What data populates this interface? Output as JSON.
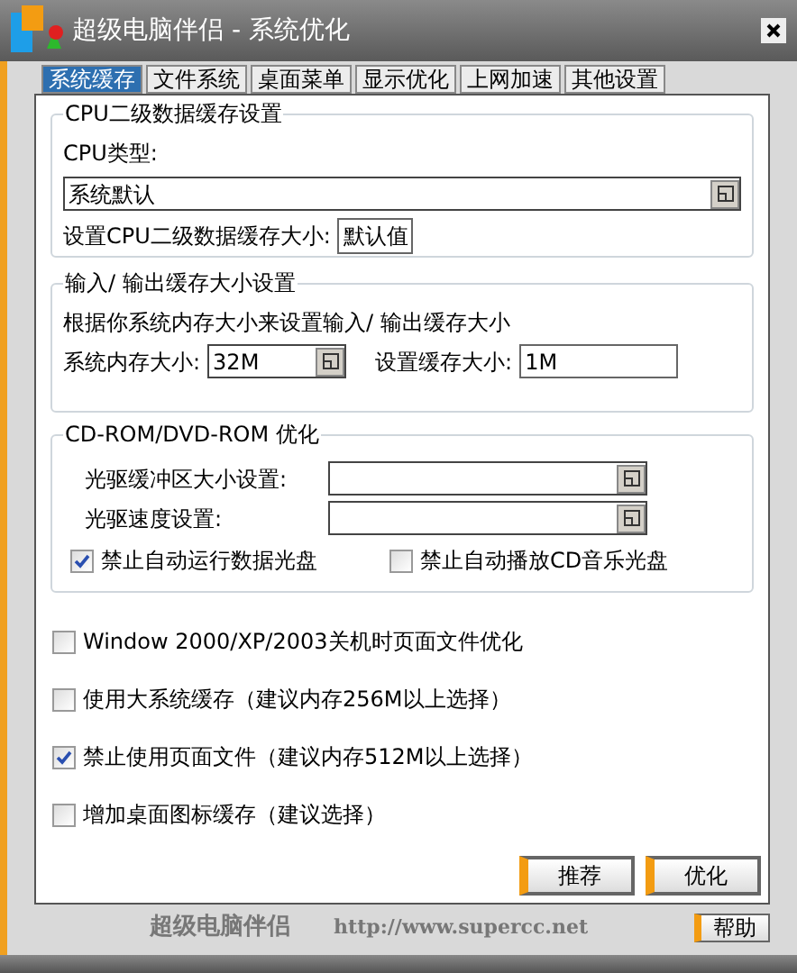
{
  "window": {
    "title": "超级电脑伴侣 - 系统优化"
  },
  "tabs": [
    {
      "label": "系统缓存",
      "selected": true
    },
    {
      "label": "文件系统",
      "selected": false
    },
    {
      "label": "桌面菜单",
      "selected": false
    },
    {
      "label": "显示优化",
      "selected": false
    },
    {
      "label": "上网加速",
      "selected": false
    },
    {
      "label": "其他设置",
      "selected": false
    }
  ],
  "cpu_group": {
    "title": "CPU二级数据缓存设置",
    "type_label": "CPU类型:",
    "type_value": "系统默认",
    "size_label": "设置CPU二级数据缓存大小:",
    "size_value": "默认值"
  },
  "io_group": {
    "title": "输入/ 输出缓存大小设置",
    "hint": "根据你系统内存大小来设置输入/ 输出缓存大小",
    "memory_label": "系统内存大小:",
    "memory_value": "32M",
    "cache_label": "设置缓存大小:",
    "cache_value": "1M"
  },
  "cdrom_group": {
    "title": "CD-ROM/DVD-ROM 优化",
    "buffer_label": "光驱缓冲区大小设置:",
    "speed_label": "光驱速度设置:",
    "checkboxes": [
      {
        "label": "禁止自动运行数据光盘",
        "checked": true
      },
      {
        "label": "禁止自动播放CD音乐光盘",
        "checked": false
      }
    ]
  },
  "options": [
    {
      "label": "Window 2000/XP/2003关机时页面文件优化",
      "checked": false
    },
    {
      "label": "使用大系统缓存（建议内存256M以上选择）",
      "checked": false
    },
    {
      "label": "禁止使用页面文件（建议内存512M以上选择）",
      "checked": true
    },
    {
      "label": "增加桌面图标缓存（建议选择）",
      "checked": false
    }
  ],
  "buttons": [
    "推荐",
    "优化"
  ],
  "footer": {
    "brand": "超级电脑伴侣",
    "url": "http://www.supercc.net",
    "help": "帮助"
  }
}
